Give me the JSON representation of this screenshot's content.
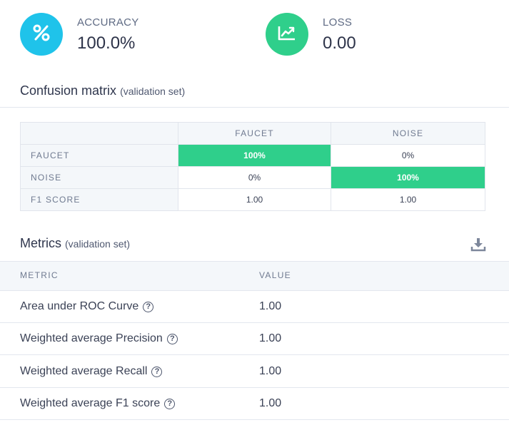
{
  "accuracy": {
    "label": "ACCURACY",
    "value": "100.0%",
    "color": "#1fc3ea",
    "icon": "percent-icon"
  },
  "loss": {
    "label": "LOSS",
    "value": "0.00",
    "color": "#2fcf8b",
    "icon": "trending-chart-icon"
  },
  "confusion": {
    "title": "Confusion matrix",
    "subtitle": "(validation set)",
    "columns": [
      "FAUCET",
      "NOISE"
    ],
    "rows": [
      {
        "label": "FAUCET",
        "cells": [
          "100%",
          "0%"
        ]
      },
      {
        "label": "NOISE",
        "cells": [
          "0%",
          "100%"
        ]
      },
      {
        "label": "F1 SCORE",
        "cells": [
          "1.00",
          "1.00"
        ]
      }
    ],
    "highlight_color": "#2fcf8b"
  },
  "metrics": {
    "title": "Metrics",
    "subtitle": "(validation set)",
    "download_icon": "download-icon",
    "headers": {
      "metric": "METRIC",
      "value": "VALUE"
    },
    "rows": [
      {
        "name": "Area under ROC Curve",
        "value": "1.00"
      },
      {
        "name": "Weighted average Precision",
        "value": "1.00"
      },
      {
        "name": "Weighted average Recall",
        "value": "1.00"
      },
      {
        "name": "Weighted average F1 score",
        "value": "1.00"
      }
    ],
    "help_glyph": "?"
  }
}
